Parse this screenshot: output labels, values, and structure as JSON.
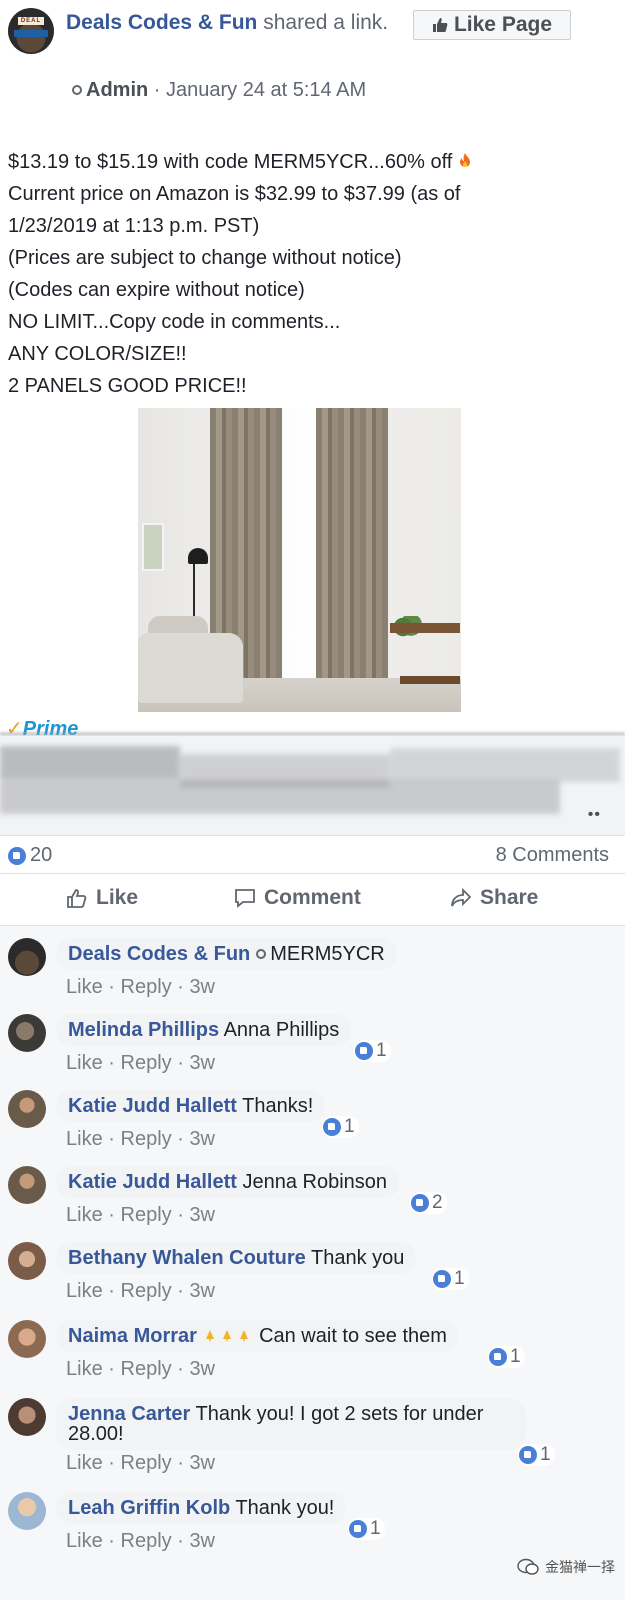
{
  "post": {
    "page_name": "Deals Codes & Fun",
    "shared_text": "shared a link.",
    "author": "Admin",
    "timestamp": "January 24 at 5:14 AM",
    "like_page_label": "Like Page",
    "body_lines": [
      "$13.19 to $15.19 with code MERM5YCR...60% off",
      "Current price on Amazon is $32.99 to $37.99 (as of",
      "1/23/2019 at 1:13 p.m. PST)",
      "(Prices are subject to change without notice)",
      "(Codes can expire without notice)",
      "NO LIMIT...Copy code in comments...",
      "ANY COLOR/SIZE!!",
      "2 PANELS GOOD PRICE!!"
    ],
    "preview_badge": "Prime"
  },
  "stats": {
    "reactions": "20",
    "comments": "8 Comments"
  },
  "actions": {
    "like": "Like",
    "comment": "Comment",
    "share": "Share"
  },
  "comment_meta": {
    "like": "Like",
    "reply": "Reply",
    "age": "3w",
    "sep": "·"
  },
  "comments": [
    {
      "name": "Deals Codes & Fun",
      "text": "MERM5YCR",
      "reactions": ""
    },
    {
      "name": "Melinda Phillips",
      "text": "Anna Phillips",
      "reactions": "1"
    },
    {
      "name": "Katie Judd Hallett",
      "text": "Thanks!",
      "reactions": "1"
    },
    {
      "name": "Katie Judd Hallett",
      "text": "Jenna Robinson",
      "reactions": "2"
    },
    {
      "name": "Bethany Whalen Couture",
      "text": "Thank you",
      "reactions": "1"
    },
    {
      "name": "Naima Morrar",
      "text": "Can wait to see them",
      "reactions": "1"
    },
    {
      "name": "Jenna Carter",
      "text": "Thank you! I got 2 sets for under 28.00!",
      "reactions": "1"
    },
    {
      "name": "Leah Griffin Kolb",
      "text": "Thank you!",
      "reactions": "1"
    }
  ],
  "watermark": "金猫禅一择",
  "colors": {
    "link_blue": "#365899",
    "like_blue": "#4a7fd8",
    "muted": "#616770"
  }
}
